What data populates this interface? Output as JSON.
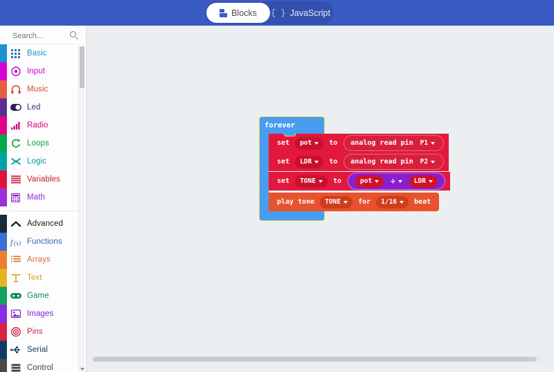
{
  "header": {
    "toggle": {
      "blocks_label": "Blocks",
      "javascript_label": "JavaScript",
      "active": "Blocks"
    },
    "background_color": "#3a5ac4"
  },
  "sidebar": {
    "search": {
      "placeholder": "Search...",
      "value": "",
      "icon": "search-icon"
    },
    "categories": [
      {
        "label": "Basic",
        "icon": "grid-icon",
        "color": "#1e90d6",
        "text_color": "#1e90d6"
      },
      {
        "label": "Input",
        "icon": "target-icon",
        "color": "#d400d4",
        "text_color": "#cc00cc"
      },
      {
        "label": "Music",
        "icon": "headphones-icon",
        "color": "#e65d41",
        "text_color": "#d2492c"
      },
      {
        "label": "Led",
        "icon": "toggle-icon",
        "color": "#5c2d91",
        "text_color": "#4b2578"
      },
      {
        "label": "Radio",
        "icon": "signal-bars-icon",
        "color": "#e3008c",
        "text_color": "#d6007f"
      },
      {
        "label": "Loops",
        "icon": "refresh-icon",
        "color": "#00a84a",
        "text_color": "#00a03f"
      },
      {
        "label": "Logic",
        "icon": "shuffle-icon",
        "color": "#00a3a3",
        "text_color": "#00999b"
      },
      {
        "label": "Variables",
        "icon": "lines-icon",
        "color": "#dc143c",
        "text_color": "#cf1532"
      },
      {
        "label": "Math",
        "icon": "calculator-icon",
        "color": "#9b30d9",
        "text_color": "#9226cf"
      }
    ],
    "advanced": {
      "label": "Advanced",
      "icon": "chevron-up-icon"
    },
    "advanced_categories": [
      {
        "label": "Functions",
        "icon": "function-icon",
        "color": "#3b6ed6",
        "text_color": "#3b5fc0"
      },
      {
        "label": "Arrays",
        "icon": "list-icon",
        "color": "#ed7d31",
        "text_color": "#d96a21"
      },
      {
        "label": "Text",
        "icon": "text-icon",
        "color": "#e6b422",
        "text_color": "#d6a413"
      },
      {
        "label": "Game",
        "icon": "gamepad-icon",
        "color": "#12a05e",
        "text_color": "#0e8e53"
      },
      {
        "label": "Images",
        "icon": "image-icon",
        "color": "#8a2be2",
        "text_color": "#7f23d6"
      },
      {
        "label": "Pins",
        "icon": "pin-target-icon",
        "color": "#d9214a",
        "text_color": "#cc1f45"
      },
      {
        "label": "Serial",
        "icon": "usb-icon",
        "color": "#0d3b66",
        "text_color": "#123a5e"
      },
      {
        "label": "Control",
        "icon": "server-icon",
        "color": "#4a4a4a",
        "text_color": "#3d3d3d"
      }
    ]
  },
  "canvas": {
    "background_color": "#eceff1",
    "program": {
      "forever": {
        "label": "forever",
        "color": "#4a9cf0",
        "selected_outline": "#d4e157"
      },
      "statements": [
        {
          "kind": "set-variable",
          "color": "#e2193c",
          "label_set": "set",
          "variable": "pot",
          "label_to": "to",
          "value_block": {
            "kind": "analog-read-pin",
            "color": "#d8203c",
            "label": "analog read pin",
            "pin": "P1"
          }
        },
        {
          "kind": "set-variable",
          "color": "#e2193c",
          "label_set": "set",
          "variable": "LDR",
          "label_to": "to",
          "value_block": {
            "kind": "analog-read-pin",
            "color": "#d8203c",
            "label": "analog read pin",
            "pin": "P2"
          }
        },
        {
          "kind": "set-variable",
          "color": "#e2193c",
          "label_set": "set",
          "variable": "TONE",
          "label_to": "to",
          "value_block": {
            "kind": "math-operation",
            "color": "#8a1fd0",
            "selected_outline": "#c47bf0",
            "left_operand": "pot",
            "operator": "÷",
            "right_operand": "LDR"
          }
        },
        {
          "kind": "play-tone",
          "color": "#e8522e",
          "label_play": "play tone",
          "tone": "TONE",
          "label_for": "for",
          "beat": "1/16",
          "label_beat": "beat"
        }
      ]
    }
  }
}
